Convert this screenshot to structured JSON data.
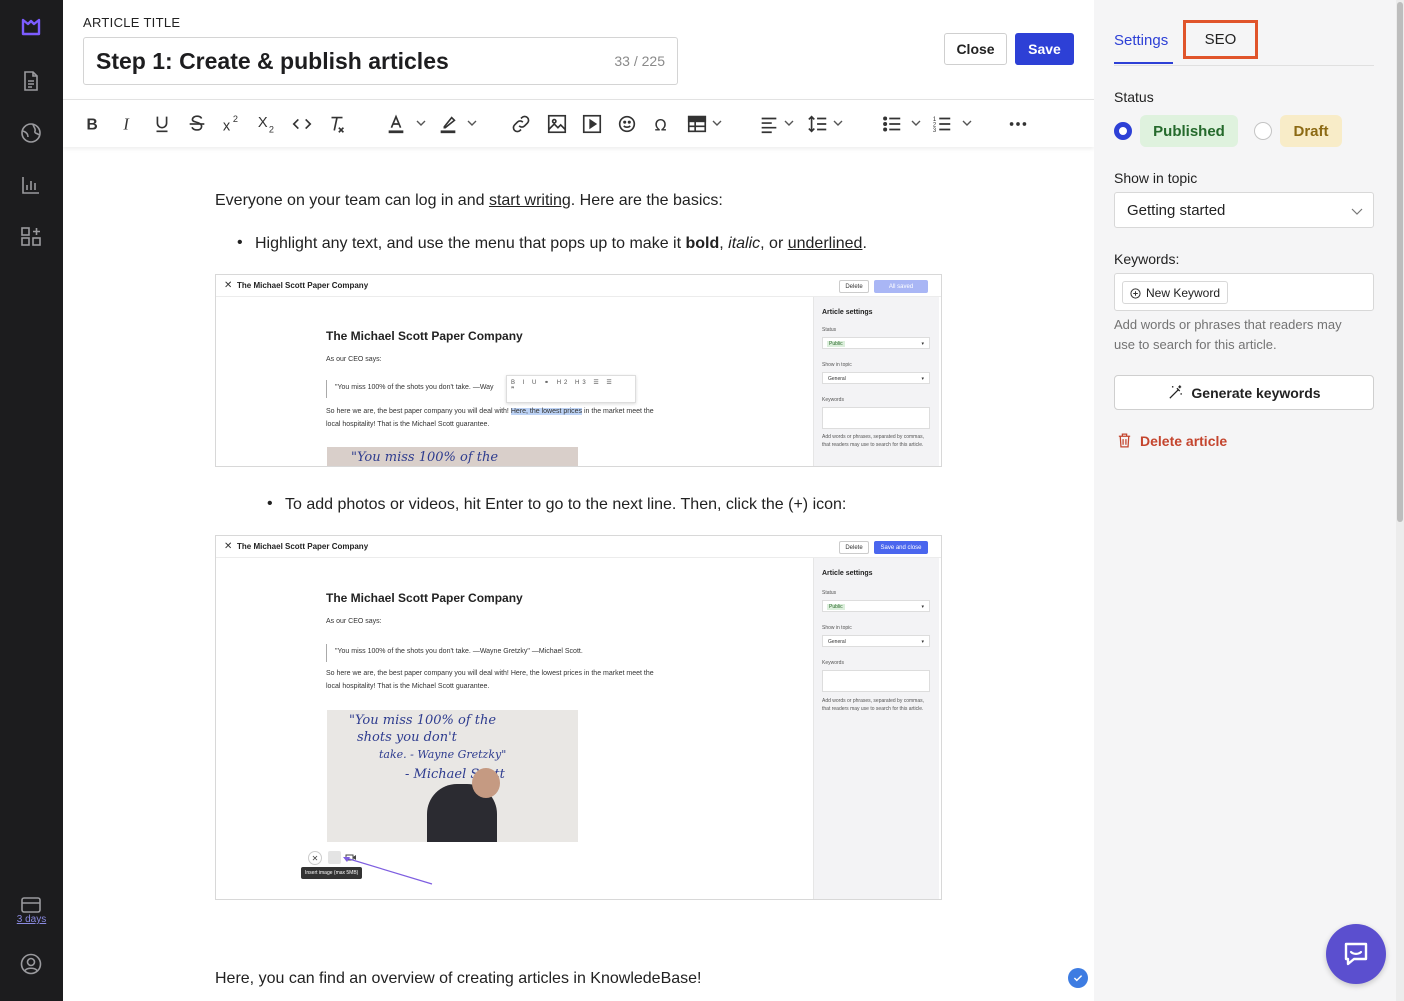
{
  "rail": {
    "trial_label": "3 days"
  },
  "editor": {
    "title_label": "ARTICLE TITLE",
    "title_value": "Step 1: Create & publish articles",
    "title_count": "33 / 225",
    "close_label": "Close",
    "save_label": "Save"
  },
  "content": {
    "p1_start": "Everyone on your team can log in and ",
    "p1_link": "start writing",
    "p1_end": ". Here are the basics:",
    "b1_start": "Highlight any text, and use the menu that pops up to make it ",
    "b1_bold": "bold",
    "b1_sep1": ", ",
    "b1_italic": "italic",
    "b1_sep2": ", or ",
    "b1_underlined": "underlined",
    "b1_end": ".",
    "b2": "To add photos or videos, hit Enter to go to the next line. Then, click the (+) icon:",
    "p_last": "Here, you can find an overview of creating articles in KnowledeBase!"
  },
  "shot1": {
    "company": "The Michael Scott Paper Company",
    "delete": "Delete",
    "primary": "All saved",
    "heading": "The Michael Scott Paper Company",
    "ceo": "As our CEO says:",
    "quote": "\"You miss 100% of the shots you don't take. —Way",
    "line1_pre": "So here we are, the best paper company you will deal with! ",
    "line1_hl": "Here, the lowest prices",
    "line1_post": " in the market meet the",
    "line2": "local hospitality! That is the Michael Scott guarantee.",
    "side_title": "Article settings",
    "status_lbl": "Status",
    "status_val": "Public",
    "topic_lbl": "Show in topic",
    "topic_val": "General",
    "kw_lbl": "Keywords",
    "kw_help": "Add words or phrases, separated by commas, that readers may use to search for this article.",
    "wb_line1": "\"You miss 100% of the"
  },
  "shot2": {
    "company": "The Michael Scott Paper Company",
    "delete": "Delete",
    "primary": "Save and close",
    "heading": "The Michael Scott Paper Company",
    "ceo": "As our CEO says:",
    "quote": "\"You miss 100% of the shots you don't take. —Wayne Gretzky\" —Michael Scott.",
    "line1": "So here we are, the best paper company you will deal with! Here, the lowest prices in the market meet the",
    "line2": "local hospitality! That is the Michael Scott guarantee.",
    "side_title": "Article settings",
    "status_lbl": "Status",
    "status_val": "Public",
    "topic_lbl": "Show in topic",
    "topic_val": "General",
    "kw_lbl": "Keywords",
    "kw_help": "Add words or phrases, separated by commas, that readers may use to search for this article.",
    "wb_line1": "\"You miss 100% of the",
    "wb_line2": "shots you don't",
    "wb_line3": "take. - Wayne Gretzky\"",
    "wb_line4": "- Michael Scott",
    "tooltip": "Insert image (max 5MB)"
  },
  "panel": {
    "tab_settings": "Settings",
    "tab_seo": "SEO",
    "status_label": "Status",
    "published": "Published",
    "draft": "Draft",
    "topic_label": "Show in topic",
    "topic_value": "Getting started",
    "keywords_label": "Keywords:",
    "keyword_chip": "New Keyword",
    "keywords_help": "Add words or phrases that readers may use to search for this article.",
    "generate_label": "Generate keywords",
    "delete_label": "Delete article"
  },
  "colors": {
    "accent": "#2d40d6",
    "highlight_box": "#e0542b",
    "published_bg": "#dff2de",
    "draft_bg": "#f8ecc8",
    "delete_red": "#c4452e",
    "chat": "#5b4fcf"
  }
}
